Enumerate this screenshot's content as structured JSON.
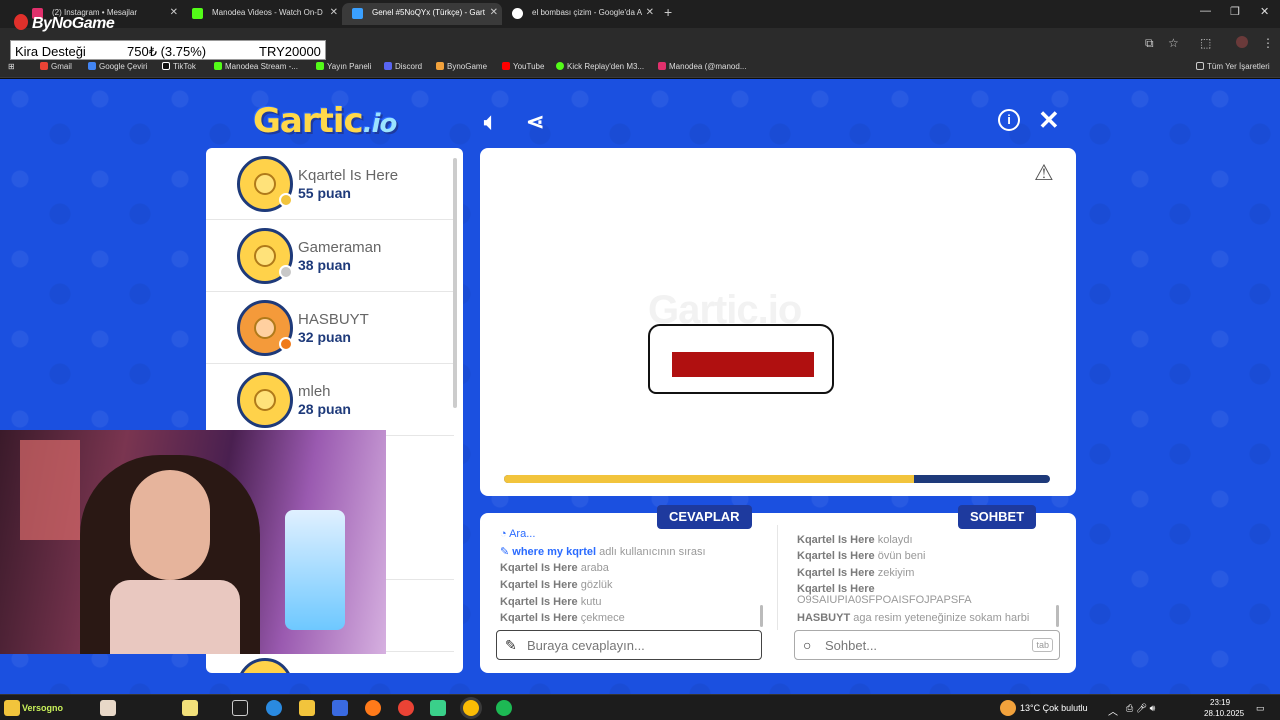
{
  "browser": {
    "tabs": [
      {
        "title": "(2) Instagram • Mesajlar",
        "color": "#e1306c"
      },
      {
        "title": "Manodea Videos - Watch On-D",
        "color": "#53fc18"
      },
      {
        "title": "Genel #5NoQYx (Türkçe) - Gart",
        "color": "#3aa0ff"
      },
      {
        "title": "el bombası çizim - Google'da A",
        "color": "#ffffff"
      }
    ],
    "bookmarks": [
      "Gmail",
      "Google Çeviri",
      "TikTok",
      "Manodea Stream -...",
      "Yayın Paneli",
      "Discord",
      "BynoGame",
      "YouTube",
      "Kick Replay'den M3...",
      "Manodea (@manod..."
    ],
    "all_bookmarks": "Tüm Yer İşaretleri"
  },
  "overlay": {
    "brand": "ByNoGame",
    "goal_label": "Kira Desteği",
    "goal_amount": "750₺ (3.75%)",
    "goal_target": "TRY20000"
  },
  "game": {
    "logo": "Gartic",
    "logo_suffix": ".io",
    "players": [
      {
        "name": "Kqartel Is Here",
        "points": "55 puan",
        "status_color": "#f2c43c"
      },
      {
        "name": "Gameraman",
        "points": "38 puan",
        "status_color": "#c8c8c8"
      },
      {
        "name": "HASBUYT",
        "points": "32 puan",
        "status_color": "#f07a1a"
      },
      {
        "name": "mleh",
        "points": "28 puan",
        "status_color": ""
      }
    ],
    "watermark": "Gartic.io",
    "timer_progress": 0.75,
    "answers_label": "CEVAPLAR",
    "chat_label": "SOHBET",
    "answers": [
      {
        "user": "",
        "text": "Ara...",
        "type": "sys"
      },
      {
        "user": "where my kqrtel",
        "text": "adlı kullanıcının sırası",
        "type": "turn"
      },
      {
        "user": "Kqartel Is Here",
        "text": "araba"
      },
      {
        "user": "Kqartel Is Here",
        "text": "gözlük"
      },
      {
        "user": "Kqartel Is Here",
        "text": "kutu"
      },
      {
        "user": "Kqartel Is Here",
        "text": "çekmece"
      }
    ],
    "chat": [
      {
        "user": "Kqartel Is Here",
        "text": "kolaydı"
      },
      {
        "user": "Kqartel Is Here",
        "text": "övün beni"
      },
      {
        "user": "Kqartel Is Here",
        "text": "zekiyim"
      },
      {
        "user": "Kqartel Is Here",
        "text": "O9SAIUPIA0SFPOAISFOJPAPSFA"
      },
      {
        "user": "HASBUYT",
        "text": "aga resim yeteneğinize sokam harbi"
      }
    ],
    "answer_placeholder": "Buraya cevaplayın...",
    "chat_placeholder": "Sohbet...",
    "tab_key": "tab"
  },
  "taskbar": {
    "search_label": "Versogno",
    "weather": "13°C  Çok bulutlu",
    "time": "23:19",
    "date": "28.10.2025"
  }
}
